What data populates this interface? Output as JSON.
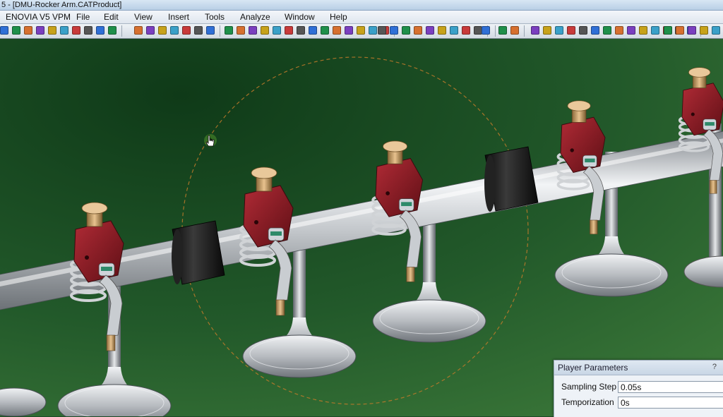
{
  "window": {
    "title": "5 - [DMU-Rocker Arm.CATProduct]"
  },
  "menu": {
    "items": [
      "ENOVIA V5 VPM",
      "File",
      "Edit",
      "View",
      "Insert",
      "Tools",
      "Analyze",
      "Window",
      "Help"
    ]
  },
  "player_parameters": {
    "title": "Player Parameters",
    "help_glyph": "?",
    "sampling_step_label": "Sampling Step",
    "sampling_step_value": "0.05s",
    "temporization_label": "Temporization",
    "temporization_value": "0s"
  },
  "colors": {
    "background_top": "#0f3a18",
    "background_bottom": "#3d7a3a",
    "rocker_red": "#8a1c24",
    "shaft_steel": "#c8ccd0",
    "spacer_black": "#151515",
    "brass": "#c89a5e"
  },
  "icons": [
    "hand-cursor-icon"
  ]
}
